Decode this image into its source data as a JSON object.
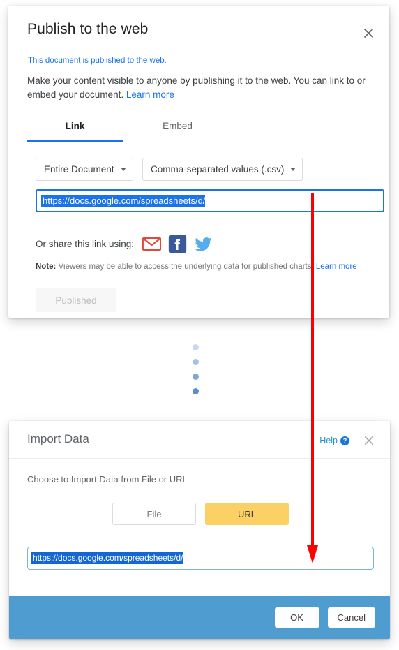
{
  "publish_dialog": {
    "title": "Publish to the web",
    "close_icon": "close-icon",
    "published_status": "This document is published to the web.",
    "description": "Make your content visible to anyone by publishing it to the web. You can link to or embed your document.",
    "description_link": "Learn more",
    "tabs": [
      {
        "label": "Link",
        "active": true
      },
      {
        "label": "Embed",
        "active": false
      }
    ],
    "scope_select": {
      "value": "Entire Document",
      "icon": "chevron-down-icon"
    },
    "format_select": {
      "value": "Comma-separated values (.csv)",
      "icon": "chevron-down-icon"
    },
    "link_input": {
      "value": "https://docs.google.com/spreadsheets/d/",
      "selected": true
    },
    "share_label": "Or share this link using:",
    "share_icons": [
      {
        "name": "gmail-icon",
        "color": "#d93025"
      },
      {
        "name": "facebook-icon",
        "color": "#3b5998"
      },
      {
        "name": "twitter-icon",
        "color": "#55acee"
      }
    ],
    "note_prefix": "Note:",
    "note_text": " Viewers may be able to access the underlying data for published charts. ",
    "note_link": "Learn more",
    "primary_button": "Published"
  },
  "transition_dots": {
    "count": 4,
    "color": "#5b8dd0",
    "opacities": [
      0.35,
      0.55,
      0.78,
      1.0
    ]
  },
  "import_dialog": {
    "title": "Import Data",
    "help_label": "Help",
    "help_icon": "help-circle-icon",
    "help_glyph": "?",
    "close_icon": "close-icon",
    "subtitle": "Choose to Import Data from File or URL",
    "source_buttons": [
      {
        "label": "File",
        "selected": false
      },
      {
        "label": "URL",
        "selected": true,
        "color": "#fbd065"
      }
    ],
    "url_input": {
      "value": "https://docs.google.com/spreadsheets/d/",
      "selected": true
    },
    "footer": {
      "background": "#4f9cd0",
      "ok_label": "OK",
      "cancel_label": "Cancel"
    }
  },
  "annotation": {
    "arrow_color": "#ff0000",
    "direction": "down",
    "description": "copy published link into import URL field"
  }
}
